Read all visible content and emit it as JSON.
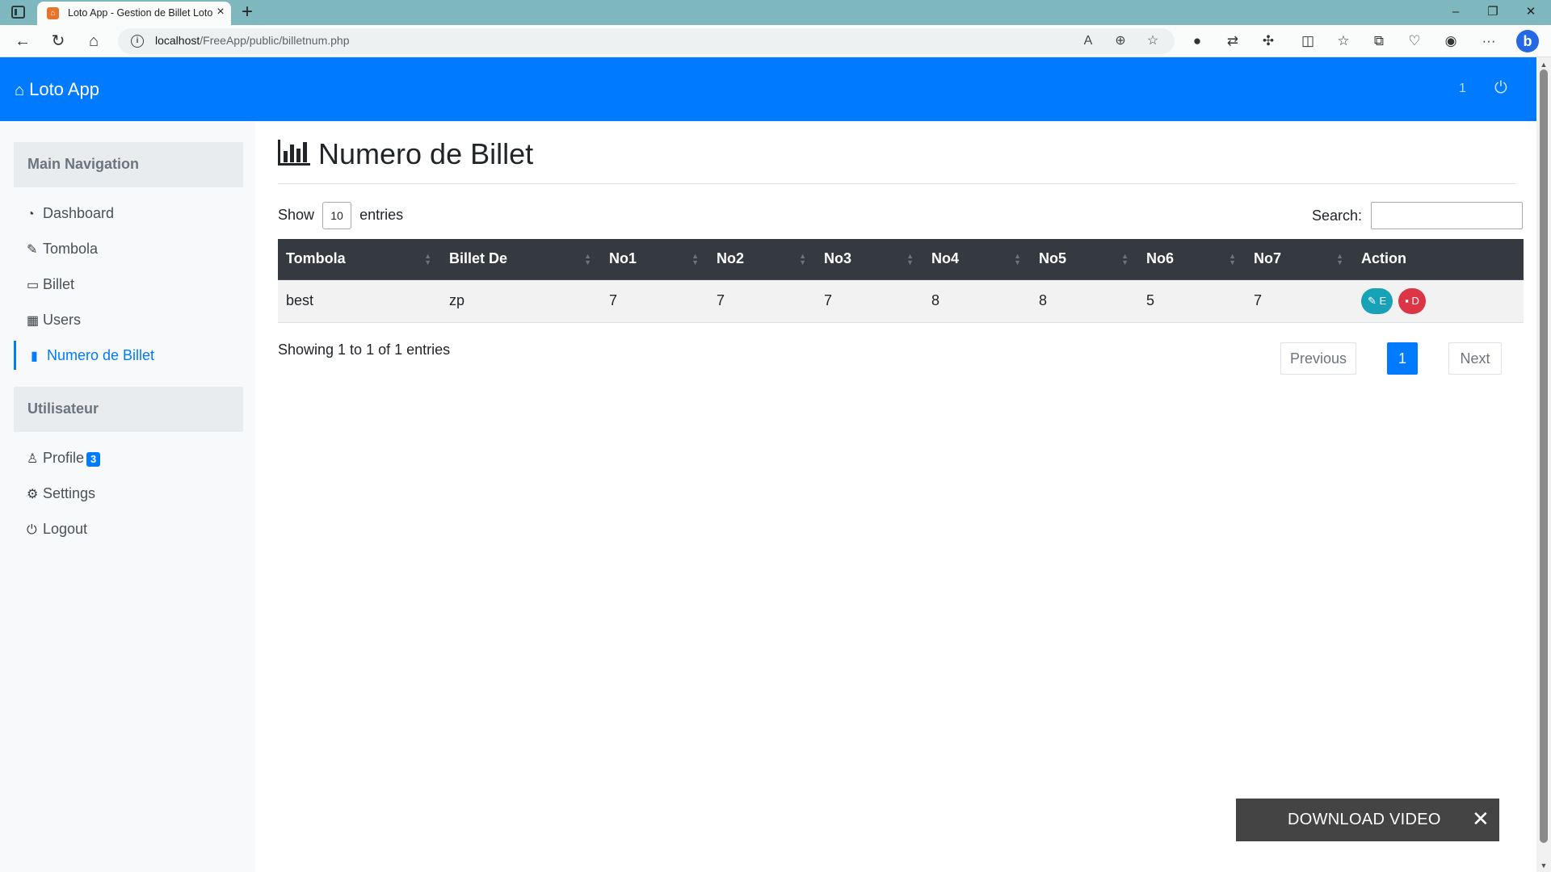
{
  "browser": {
    "tab_title": "Loto App - Gestion de Billet Loto",
    "url_host": "localhost",
    "url_path": "/FreeApp/public/billetnum.php"
  },
  "header": {
    "brand": "Loto App",
    "count": "1"
  },
  "sidebar": {
    "sections": [
      "Main Navigation",
      "Utilisateur"
    ],
    "items": [
      {
        "label": "Dashboard",
        "icon": "dashboard-icon"
      },
      {
        "label": "Tombola",
        "icon": "edit-icon"
      },
      {
        "label": "Billet",
        "icon": "monitor-icon"
      },
      {
        "label": "Users",
        "icon": "table-icon"
      },
      {
        "label": "Numero de Billet",
        "icon": "bar-chart-icon"
      }
    ],
    "user_items": [
      {
        "label": "Profile",
        "icon": "user-icon",
        "badge": "3"
      },
      {
        "label": "Settings",
        "icon": "gear-icon"
      },
      {
        "label": "Logout",
        "icon": "power-icon"
      }
    ]
  },
  "main": {
    "title": "Numero de Billet",
    "show_label": "Show",
    "entries_label": "entries",
    "page_length": "10",
    "search_label": "Search:",
    "search_value": "",
    "columns": [
      "Tombola",
      "Billet De",
      "No1",
      "No2",
      "No3",
      "No4",
      "No5",
      "No6",
      "No7",
      "Action"
    ],
    "rows": [
      {
        "cells": [
          "best",
          "zp",
          "7",
          "7",
          "7",
          "8",
          "8",
          "5",
          "7"
        ],
        "edit": "E",
        "delete": "D"
      }
    ],
    "info": "Showing 1 to 1 of 1 entries",
    "pagination": {
      "previous": "Previous",
      "current": "1",
      "next": "Next"
    }
  },
  "overlay": {
    "download_label": "DOWNLOAD VIDEO",
    "close": "✕"
  },
  "colors": {
    "primary": "#007bff",
    "table_header": "#343a40",
    "edit": "#17a2b8",
    "delete": "#dc3545"
  }
}
